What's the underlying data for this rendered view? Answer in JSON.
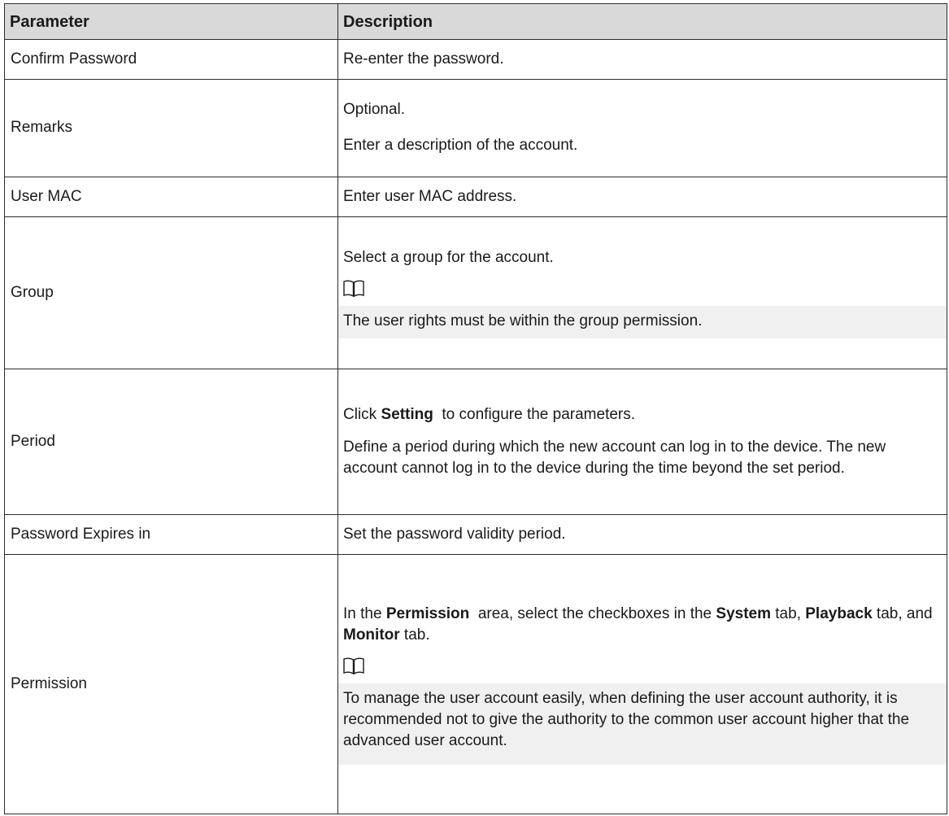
{
  "table": {
    "headers": [
      "Parameter",
      "Description"
    ],
    "rows": {
      "confirm_password": {
        "name": "Confirm Password",
        "desc": "Re-enter the password."
      },
      "remarks": {
        "name": "Remarks",
        "line1": "Optional.",
        "line2": "Enter a description of the account."
      },
      "user_mac": {
        "name": "User MAC",
        "desc": "Enter user MAC address."
      },
      "group": {
        "name": "Group",
        "line1": "Select a group for the account.",
        "note_icon": "book-note-icon",
        "note": "The user rights must be within the group permission."
      },
      "period": {
        "name": "Period",
        "line1_pre": "Click ",
        "line1_bold": "Setting",
        "line1_post": "  to configure the parameters.",
        "line2": "Define a period during which the new account can log in to the device. The new account cannot log in to the device during the time beyond the set period."
      },
      "password_expires": {
        "name": "Password Expires in",
        "desc": "Set the password validity period."
      },
      "permission": {
        "name": "Permission",
        "p1_a": "In the ",
        "p1_b": "Permission",
        "p1_c": "  area, select the checkboxes in the ",
        "p1_d": "System",
        "p1_e": " tab, ",
        "p1_f": "Playback",
        "p1_g": " tab, and ",
        "p1_h": "Monitor",
        "p1_i": " tab.",
        "note_icon": "book-note-icon",
        "note": "To manage the user account easily, when defining the user account authority, it is recommended not to give the authority to the common user account higher that the advanced user account."
      }
    }
  }
}
